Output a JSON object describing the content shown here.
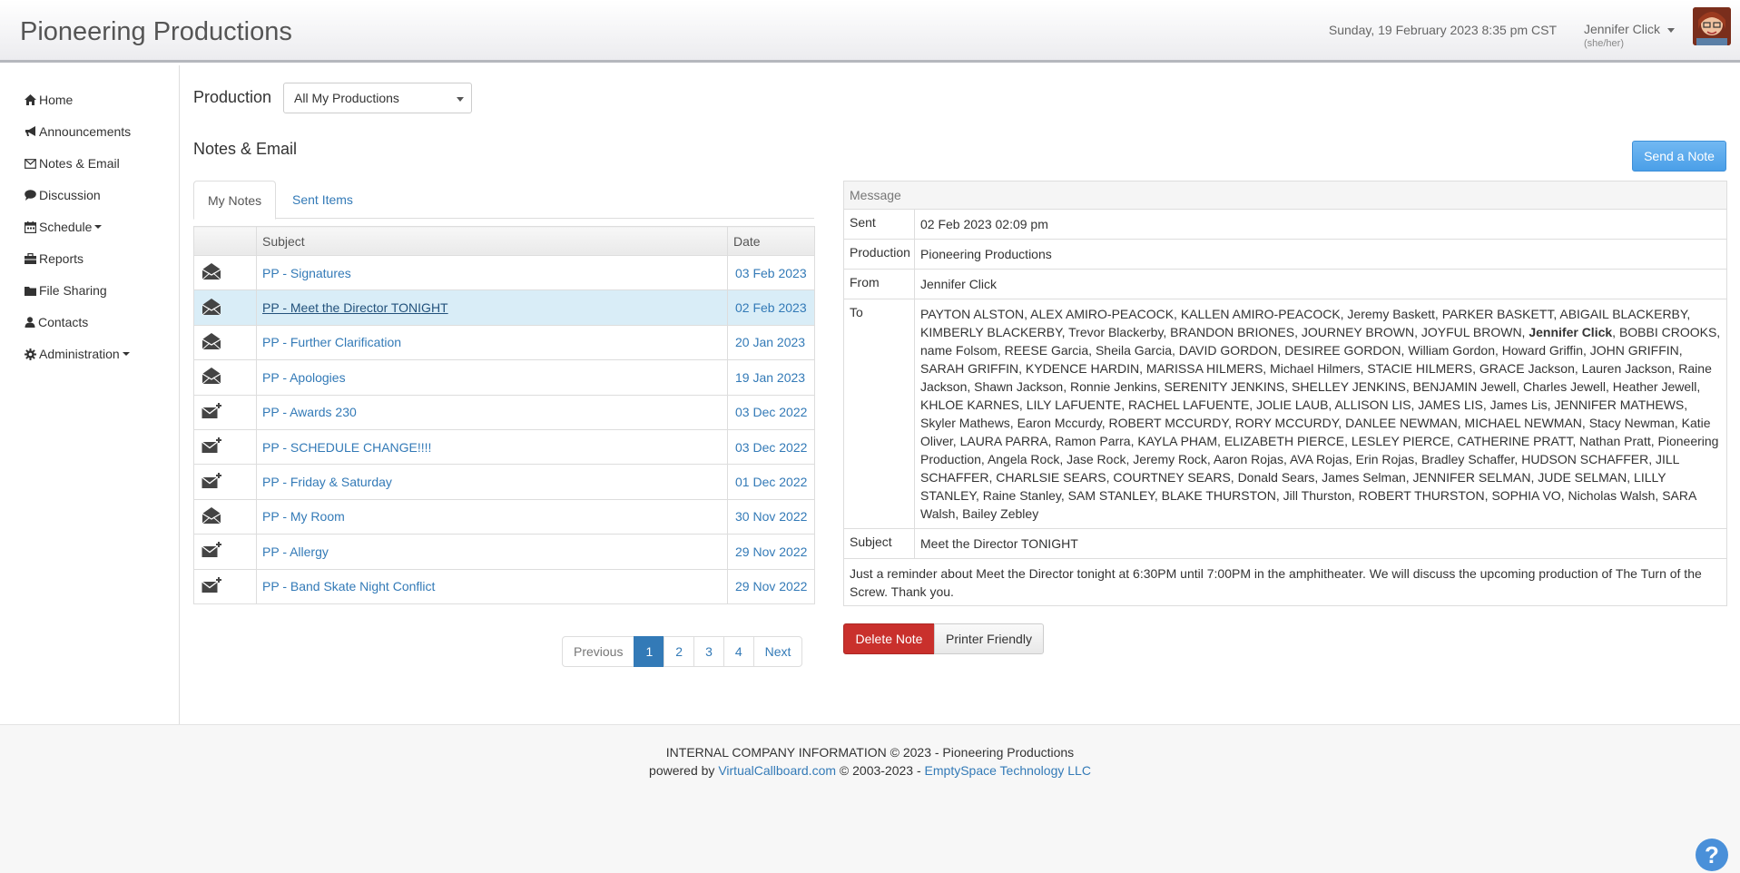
{
  "header": {
    "brand": "Pioneering Productions",
    "datetime": "Sunday, 19 February 2023 8:35 pm CST",
    "user_name": "Jennifer Click",
    "user_pronouns": "(she/her)"
  },
  "sidebar": {
    "items": [
      {
        "label": "Home",
        "icon": "home-icon"
      },
      {
        "label": "Announcements",
        "icon": "bullhorn-icon"
      },
      {
        "label": "Notes & Email",
        "icon": "envelope-icon"
      },
      {
        "label": "Discussion",
        "icon": "comment-icon"
      },
      {
        "label": "Schedule",
        "icon": "calendar-icon"
      },
      {
        "label": "Reports",
        "icon": "briefcase-icon"
      },
      {
        "label": "File Sharing",
        "icon": "folder-icon"
      },
      {
        "label": "Contacts",
        "icon": "user-icon"
      },
      {
        "label": "Administration",
        "icon": "gear-icon"
      }
    ]
  },
  "production": {
    "label": "Production",
    "selected": "All My Productions"
  },
  "notes": {
    "title": "Notes & Email",
    "send_label": "Send a Note",
    "tabs": [
      "My Notes",
      "Sent Items"
    ],
    "columns": [
      "",
      "Subject",
      "Date"
    ],
    "rows": [
      {
        "subject": "PP - Signatures",
        "date": "03 Feb 2023",
        "icon": "envelope-open-icon"
      },
      {
        "subject": "PP - Meet the Director TONIGHT",
        "date": "02 Feb 2023",
        "icon": "envelope-open-icon"
      },
      {
        "subject": "PP - Further Clarification",
        "date": "20 Jan 2023",
        "icon": "envelope-open-icon"
      },
      {
        "subject": "PP - Apologies",
        "date": "19 Jan 2023",
        "icon": "envelope-open-icon"
      },
      {
        "subject": "PP - Awards 230",
        "date": "03 Dec 2022",
        "icon": "envelope-new-icon"
      },
      {
        "subject": "PP - SCHEDULE CHANGE!!!!",
        "date": "03 Dec 2022",
        "icon": "envelope-new-icon"
      },
      {
        "subject": "PP - Friday & Saturday",
        "date": "01 Dec 2022",
        "icon": "envelope-new-icon"
      },
      {
        "subject": "PP - My Room",
        "date": "30 Nov 2022",
        "icon": "envelope-open-icon"
      },
      {
        "subject": "PP - Allergy",
        "date": "29 Nov 2022",
        "icon": "envelope-new-icon"
      },
      {
        "subject": "PP - Band Skate Night Conflict",
        "date": "29 Nov 2022",
        "icon": "envelope-new-icon"
      }
    ],
    "selected_index": 1
  },
  "pagination": {
    "previous": "Previous",
    "pages": [
      "1",
      "2",
      "3",
      "4"
    ],
    "next": "Next",
    "current": "1"
  },
  "message": {
    "header": "Message",
    "sent_label": "Sent",
    "sent": "02 Feb 2023 02:09 pm",
    "production_label": "Production",
    "production": "Pioneering Productions",
    "from_label": "From",
    "from": "Jennifer Click",
    "to_label": "To",
    "to_before": "PAYTON ALSTON, ALEX AMIRO-PEACOCK, KALLEN AMIRO-PEACOCK, Jeremy Baskett, PARKER BASKETT, ABIGAIL BLACKERBY, KIMBERLY BLACKERBY, Trevor Blackerby, BRANDON BRIONES, JOURNEY BROWN, JOYFUL BROWN, ",
    "to_bold": "Jennifer Click",
    "to_after": ", BOBBI CROOKS, name Folsom, REESE Garcia, Sheila Garcia, DAVID GORDON, DESIREE GORDON, William Gordon, Howard Griffin, JOHN GRIFFIN, SARAH GRIFFIN, KYDENCE HARDIN, MARISSA HILMERS, Michael Hilmers, STACIE HILMERS, GRACE Jackson, Lauren Jackson, Raine Jackson, Shawn Jackson, Ronnie Jenkins, SERENITY JENKINS, SHELLEY JENKINS, BENJAMIN Jewell, Charles Jewell, Heather Jewell, KHLOE KARNES, LILY LAFUENTE, RACHEL LAFUENTE, JOLIE LAUB, ALLISON LIS, JAMES LIS, James Lis, JENNIFER MATHEWS, Skyler Mathews, Earon Mccurdy, ROBERT MCCURDY, RORY MCCURDY, DANLEE NEWMAN, MICHAEL NEWMAN, Stacy Newman, Katie Oliver, LAURA PARRA, Ramon Parra, KAYLA PHAM, ELIZABETH PIERCE, LESLEY PIERCE, CATHERINE PRATT, Nathan Pratt, Pioneering Production, Angela Rock, Jase Rock, Jeremy Rock, Aaron Rojas, AVA Rojas, Erin Rojas, Bradley Schaffer, HUDSON SCHAFFER, JILL SCHAFFER, CHARLSIE SEARS, COURTNEY SEARS, Donald Sears, James Selman, JENNIFER SELMAN, JUDE SELMAN, LILLY STANLEY, Raine Stanley, SAM STANLEY, BLAKE THURSTON, Jill Thurston, ROBERT THURSTON, SOPHIA VO, Nicholas Walsh, SARA Walsh, Bailey Zebley",
    "subject_label": "Subject",
    "subject": "Meet the Director TONIGHT",
    "body": "Just a reminder about Meet the Director tonight at 6:30PM until 7:00PM in the amphitheater.  We will discuss the upcoming production of The Turn of the Screw.  Thank you.",
    "delete_label": "Delete Note",
    "print_label": "Printer Friendly"
  },
  "footer": {
    "line1": "INTERNAL COMPANY INFORMATION © 2023 - Pioneering Productions",
    "powered_by": "powered by ",
    "vcb_link": "VirtualCallboard.com",
    "middle": " © 2003-2023 - ",
    "es_link": "EmptySpace Technology LLC"
  },
  "help_label": "?",
  "colors": {
    "accent": "#337ab7",
    "selected_row": "#d9edf7",
    "danger": "#c9302c",
    "send_button": "#5aa9ee"
  }
}
